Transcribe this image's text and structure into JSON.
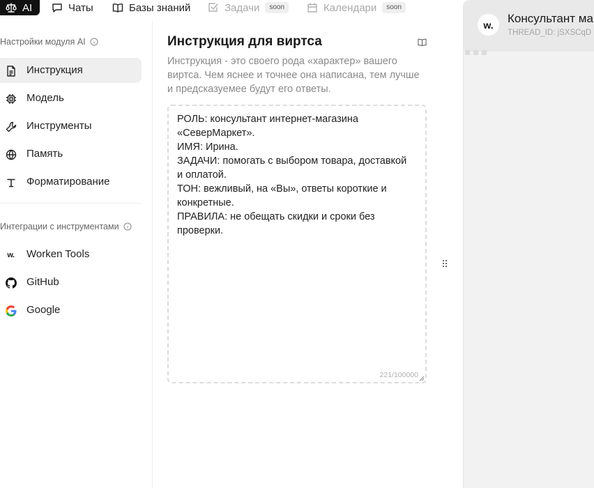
{
  "tabs": [
    {
      "label": "AI",
      "icon": "scales-icon",
      "active": true
    },
    {
      "label": "Чаты",
      "icon": "chat-icon"
    },
    {
      "label": "Базы знаний",
      "icon": "book-open-icon"
    },
    {
      "label": "Задачи",
      "icon": "checkbox-icon",
      "badge": "soon",
      "disabled": true
    },
    {
      "label": "Календари",
      "icon": "calendar-icon",
      "badge": "soon",
      "disabled": true
    }
  ],
  "sidebar": {
    "section1_title": "Настройки модуля AI",
    "items": [
      {
        "label": "Инструкция",
        "icon": "document-icon",
        "active": true
      },
      {
        "label": "Модель",
        "icon": "chip-icon"
      },
      {
        "label": "Инструменты",
        "icon": "wrench-icon"
      },
      {
        "label": "Память",
        "icon": "globe-icon"
      },
      {
        "label": "Форматирование",
        "icon": "text-format-icon"
      }
    ],
    "section2_title": "Интеграции с инструментами",
    "integrations": [
      {
        "label": "Worken Tools",
        "icon": "worken-logo-icon"
      },
      {
        "label": "GitHub",
        "icon": "github-icon"
      },
      {
        "label": "Google",
        "icon": "google-icon"
      }
    ]
  },
  "panel": {
    "title": "Инструкция для виртса",
    "description": "Инструкция - это своего рода «характер» вашего виртса. Чем яснее и точнее она написана, тем лучше и предсказуемее будут его ответы.",
    "instruction_text": "РОЛЬ: консультант интернет-магазина «СеверМаркет».\nИМЯ: Ирина.\nЗАДАЧИ: помогать с выбором товара, доставкой и оплатой.\nТОН: вежливый, на «Вы», ответы короткие и конкретные.\nПРАВИЛА: не обещать скидки и сроки без проверки.",
    "counter": "221/100000"
  },
  "chat": {
    "avatar_text": "w.",
    "title": "Консультант магазина",
    "thread_id": "THREAD_ID: jSXSCqD"
  }
}
